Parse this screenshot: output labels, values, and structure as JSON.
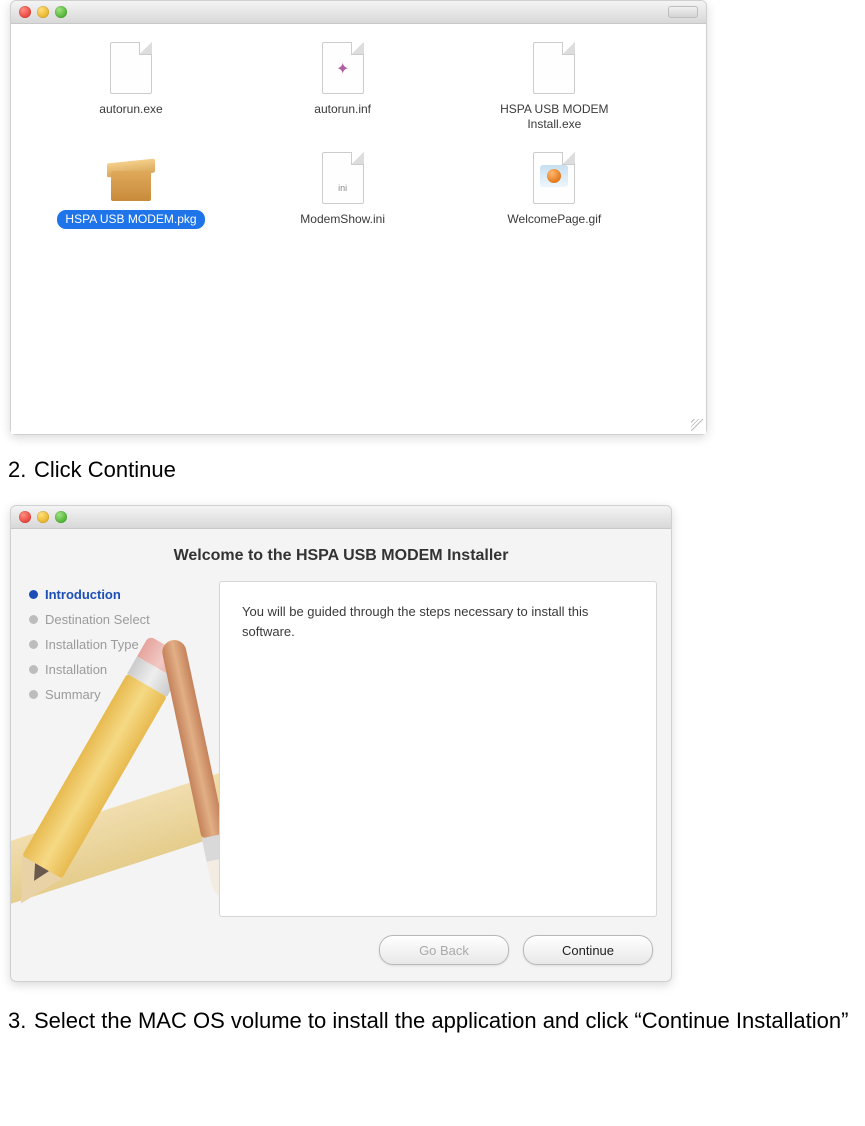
{
  "finder": {
    "files": [
      {
        "name": "autorun.exe",
        "icon": "file-blank"
      },
      {
        "name": "autorun.inf",
        "icon": "file-config"
      },
      {
        "name": "HSPA USB MODEM\nInstall.exe",
        "icon": "file-blank"
      },
      {
        "name": "HSPA USB MODEM.pkg",
        "icon": "pkg",
        "selected": true
      },
      {
        "name": "ModemShow.ini",
        "icon": "file-ini"
      },
      {
        "name": "WelcomePage.gif",
        "icon": "file-gif"
      }
    ]
  },
  "steps": {
    "step2_num": "2.",
    "step2_text": "Click Continue",
    "step3_num": "3.",
    "step3_text": "Select the MAC OS volume to install the application and click “Continue Installation”"
  },
  "installer": {
    "heading": "Welcome to the HSPA USB MODEM Installer",
    "sidebar": [
      {
        "label": "Introduction",
        "active": true
      },
      {
        "label": "Destination Select",
        "active": false
      },
      {
        "label": "Installation Type",
        "active": false
      },
      {
        "label": "Installation",
        "active": false
      },
      {
        "label": "Summary",
        "active": false
      }
    ],
    "main_text": "You will be guided through the steps necessary to install this software.",
    "buttons": {
      "back": "Go Back",
      "continue": "Continue"
    }
  }
}
